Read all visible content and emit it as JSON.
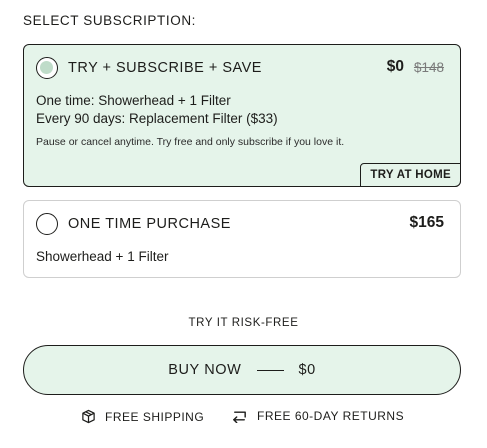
{
  "heading": "SELECT SUBSCRIPTION:",
  "options": [
    {
      "label": "TRY + SUBSCRIBE + SAVE",
      "price": "$0",
      "old_price": "$148",
      "line1": "One time: Showerhead + 1 Filter",
      "line2": "Every 90 days: Replacement Filter ($33)",
      "note": "Pause or cancel anytime. Try free and only subscribe if you love it.",
      "badge": "TRY AT HOME",
      "selected": true
    },
    {
      "label": "ONE TIME PURCHASE",
      "price": "$165",
      "line1": "Showerhead + 1 Filter",
      "selected": false
    }
  ],
  "risk_free": "TRY IT RISK-FREE",
  "buy": {
    "label": "BUY NOW",
    "price": "$0"
  },
  "perks": {
    "shipping": {
      "label": "FREE SHIPPING",
      "icon": "box-icon"
    },
    "returns": {
      "label": "FREE 60-DAY RETURNS",
      "icon": "return-arrow-icon"
    }
  },
  "colors": {
    "selected_bg": "#e5f4ea",
    "radio_fill": "#bfdcc9",
    "text": "#1d1d1b",
    "muted": "#7a7a7a"
  }
}
